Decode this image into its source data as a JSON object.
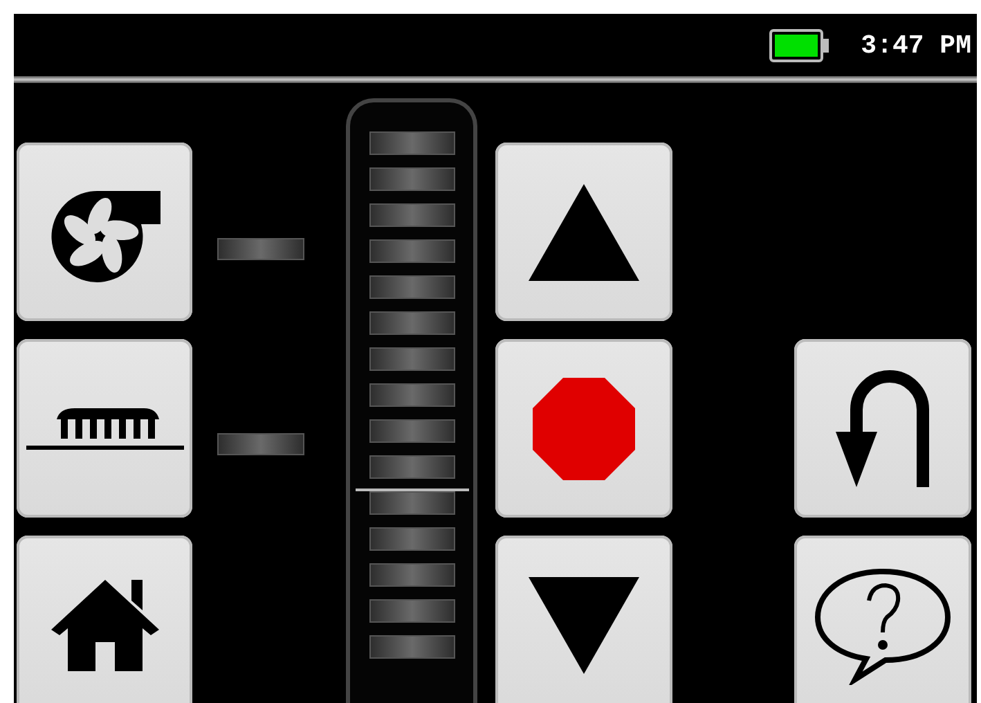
{
  "status_bar": {
    "time": "3:47 PM"
  },
  "left_buttons": [
    {
      "kind": "fan"
    },
    {
      "kind": "heater"
    },
    {
      "kind": "home"
    }
  ],
  "indicators": [
    {
      "on": false
    },
    {
      "on": false
    }
  ],
  "level_meter": {
    "segments": [
      {
        "on": false,
        "marked": false
      },
      {
        "on": false,
        "marked": false
      },
      {
        "on": false,
        "marked": false
      },
      {
        "on": false,
        "marked": false
      },
      {
        "on": false,
        "marked": false
      },
      {
        "on": false,
        "marked": false
      },
      {
        "on": false,
        "marked": false
      },
      {
        "on": false,
        "marked": false
      },
      {
        "on": false,
        "marked": false
      },
      {
        "on": false,
        "marked": true
      },
      {
        "on": false,
        "marked": false
      },
      {
        "on": false,
        "marked": false
      },
      {
        "on": false,
        "marked": false
      },
      {
        "on": false,
        "marked": false
      },
      {
        "on": false,
        "marked": false
      }
    ]
  },
  "middle_buttons": [
    {
      "kind": "up"
    },
    {
      "kind": "stop"
    },
    {
      "kind": "down"
    }
  ],
  "right_buttons": [
    {
      "kind": "back"
    },
    {
      "kind": "help"
    }
  ]
}
